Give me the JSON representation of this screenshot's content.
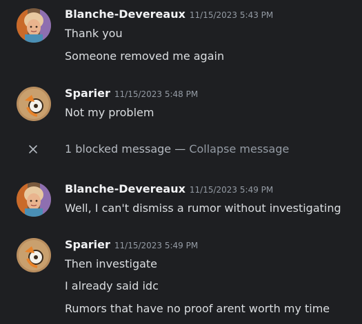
{
  "messages": [
    {
      "username": "Blanche-Devereaux",
      "timestamp": "11/15/2023 5:43 PM",
      "lines": [
        "Thank you",
        "Someone removed me again"
      ]
    },
    {
      "username": "Sparier",
      "timestamp": "11/15/2023 5:48 PM",
      "lines": [
        "Not my problem"
      ]
    },
    {
      "username": "Blanche-Devereaux",
      "timestamp": "11/15/2023 5:49 PM",
      "lines": [
        "Well, I can't dismiss a rumor without investigating"
      ]
    },
    {
      "username": "Sparier",
      "timestamp": "11/15/2023 5:49 PM",
      "lines": [
        "Then investigate",
        "I already said idc",
        "Rumors that have no proof arent worth my time"
      ]
    }
  ],
  "blocked": {
    "text": "1 blocked message —",
    "collapse_label": "Collapse message",
    "icon": "close-icon"
  },
  "colors": {
    "background": "#1e1f22",
    "username": "#f2f3f5",
    "timestamp": "#949ba4",
    "text": "#dbdee1"
  }
}
